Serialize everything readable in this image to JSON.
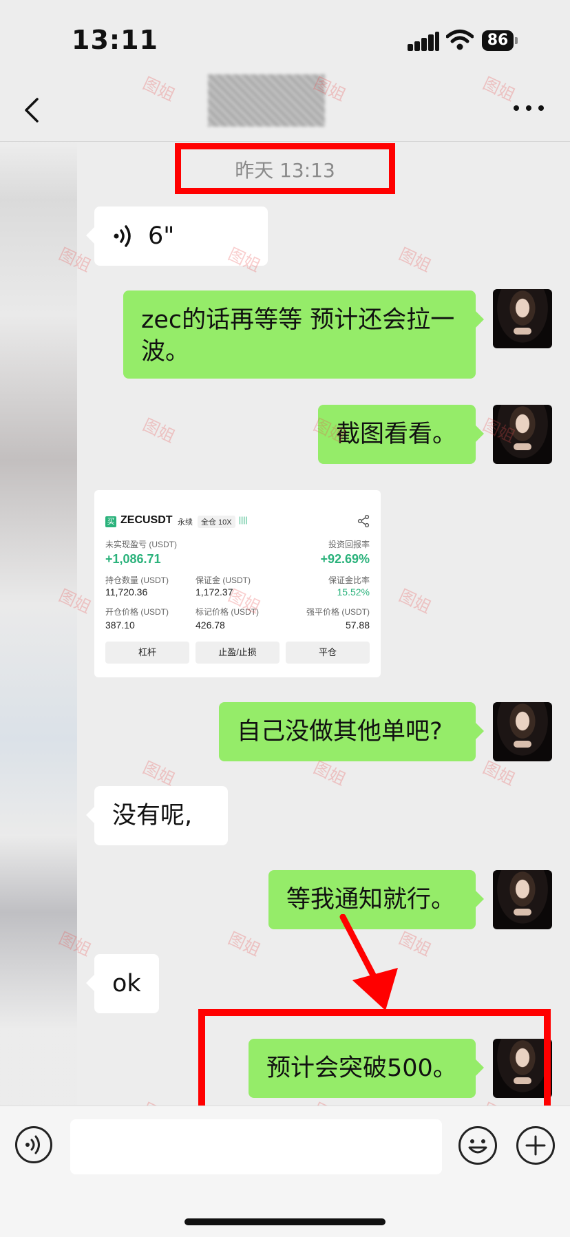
{
  "status_bar": {
    "time": "13:11",
    "battery": "86"
  },
  "nav": {
    "back_icon": "chevron-left-icon",
    "more_icon": "more-dots-icon"
  },
  "timestamp": "昨天 13:13",
  "messages": [
    {
      "id": "voice",
      "sender": "them",
      "type": "voice",
      "duration": "6\""
    },
    {
      "id": "m1",
      "sender": "me",
      "text": "zec的话再等等 预计还会拉一波。"
    },
    {
      "id": "m2",
      "sender": "me",
      "text": "截图看看。"
    },
    {
      "id": "m3",
      "sender": "them",
      "type": "image"
    },
    {
      "id": "m4",
      "sender": "me",
      "text": "自己没做其他单吧?"
    },
    {
      "id": "m5",
      "sender": "them",
      "text": "没有呢,"
    },
    {
      "id": "m6",
      "sender": "me",
      "text": "等我通知就行。"
    },
    {
      "id": "m7",
      "sender": "them",
      "text": "ok"
    },
    {
      "id": "m8",
      "sender": "me",
      "text": "预计会突破500。"
    }
  ],
  "card": {
    "buy_tag": "买",
    "symbol": "ZECUSDT",
    "type": "永续",
    "mode": "全仓 10X",
    "bars": "||||",
    "unrealized_label": "未实现盈亏 (USDT)",
    "unrealized_value": "+1,086.71",
    "roi_label": "投资回报率",
    "roi_value": "+92.69%",
    "position_label": "持仓数量 (USDT)",
    "position_value": "11,720.36",
    "margin_label": "保证金 (USDT)",
    "margin_value": "1,172.37",
    "margin_ratio_label": "保证金比率",
    "margin_ratio_value": "15.52%",
    "entry_label": "开仓价格 (USDT)",
    "entry_value": "387.10",
    "mark_label": "标记价格 (USDT)",
    "mark_value": "426.78",
    "liq_label": "强平价格 (USDT)",
    "liq_value": "57.88",
    "btn_leverage": "杠杆",
    "btn_tpsl": "止盈/止损",
    "btn_close": "平仓"
  },
  "watermark": "图姐",
  "colors": {
    "out_bubble": "#95ec69",
    "in_bubble": "#ffffff",
    "highlight": "#ff0000",
    "profit": "#2ab27b"
  },
  "input_bar": {
    "voice_icon": "voice-toggle-icon",
    "emoji_icon": "emoji-icon",
    "add_icon": "plus-icon",
    "placeholder": ""
  }
}
